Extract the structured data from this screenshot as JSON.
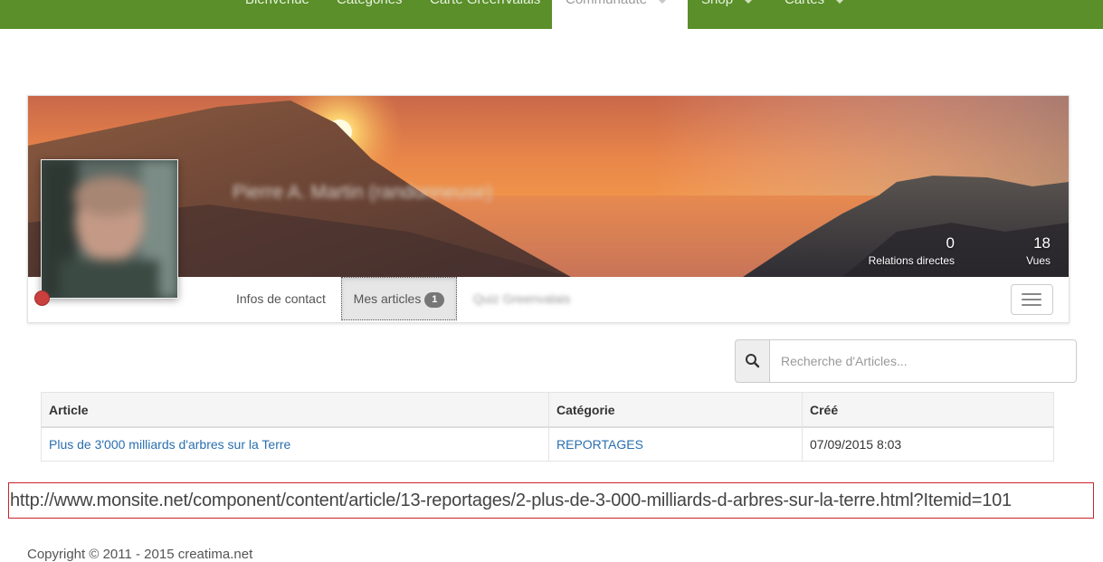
{
  "nav": {
    "items": [
      {
        "label": "Bienvenue",
        "active": false,
        "dropdown": false
      },
      {
        "label": "Catégories",
        "active": false,
        "dropdown": false
      },
      {
        "label": "Carte GreenValais",
        "active": false,
        "dropdown": false
      },
      {
        "label": "Communauté",
        "active": true,
        "dropdown": true
      },
      {
        "label": "Shop",
        "active": false,
        "dropdown": true
      },
      {
        "label": "Cartes",
        "active": false,
        "dropdown": true
      }
    ],
    "bar_color": "#5a8f2a"
  },
  "profile": {
    "name": "Pierre A. Martin (randonneuse)",
    "status_color": "#c9403e",
    "stats": [
      {
        "value": "0",
        "label": "Relations directes"
      },
      {
        "value": "18",
        "label": "Vues"
      }
    ],
    "tabs": [
      {
        "label": "Infos de contact",
        "active": false
      },
      {
        "label": "Mes articles",
        "active": true,
        "badge": "1"
      },
      {
        "label": "Quiz Greenvalais",
        "active": false,
        "blurred": true
      }
    ]
  },
  "search": {
    "placeholder": "Recherche d'Articles...",
    "icon": "search-icon"
  },
  "articles": {
    "columns": [
      "Article",
      "Catégorie",
      "Créé"
    ],
    "rows": [
      {
        "title": "Plus de 3'000 milliards d'arbres sur la Terre",
        "category": "REPORTAGES",
        "created": "07/09/2015 8:03"
      }
    ]
  },
  "annotation": {
    "url": "http://www.monsite.net/component/content/article/13-reportages/2-plus-de-3-000-milliards-d-arbres-sur-la-terre.html?Itemid=101",
    "border_color": "#c8242b"
  },
  "footer": {
    "copyright": "Copyright © 2011 - 2015 creatima.net"
  }
}
